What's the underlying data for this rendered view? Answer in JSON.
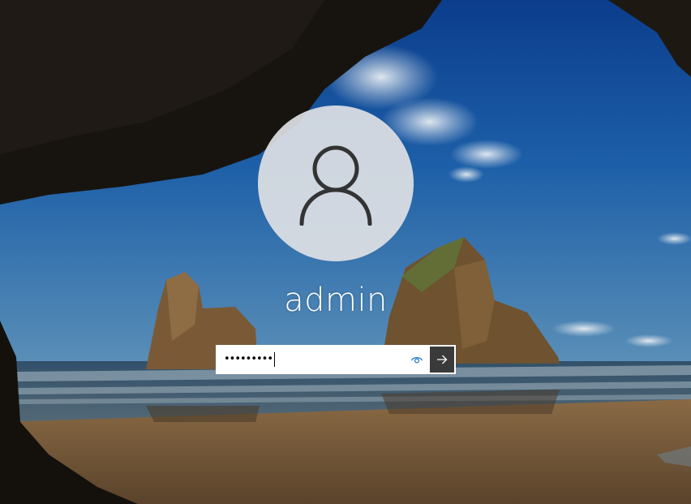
{
  "background": {
    "name": "beach-cave-wallpaper"
  },
  "user": {
    "avatar_icon": "user-silhouette-icon",
    "name": "admin"
  },
  "password": {
    "masked_value": "•••••••••",
    "reveal_icon": "eye-icon"
  },
  "submit": {
    "icon": "arrow-right-icon"
  },
  "colors": {
    "avatar_bg": "#dee1e4",
    "avatar_glyph": "#333333",
    "submit_bg": "#3a3a3a",
    "reveal_icon": "#1e7bc9",
    "text": "#ffffff"
  }
}
